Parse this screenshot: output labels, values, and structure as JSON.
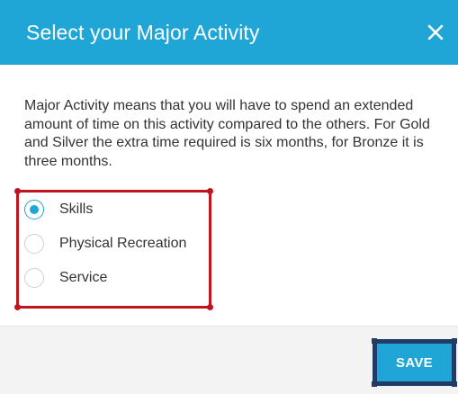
{
  "dialog": {
    "title": "Select your Major Activity",
    "close_icon": "close-icon",
    "description": "Major Activity means that you will have to spend an extended amount of time on this activity compared to the others. For Gold and Silver the extra time required is six months, for Bronze it is three months.",
    "options": [
      {
        "label": "Skills",
        "checked": true
      },
      {
        "label": "Physical Recreation",
        "checked": false
      },
      {
        "label": "Service",
        "checked": false
      }
    ],
    "save_label": "SAVE"
  },
  "colors": {
    "header": "#1fa6d6",
    "accent": "#1fa6d6",
    "highlight_box": "#c0151f",
    "save_outline": "#1f3b66"
  }
}
